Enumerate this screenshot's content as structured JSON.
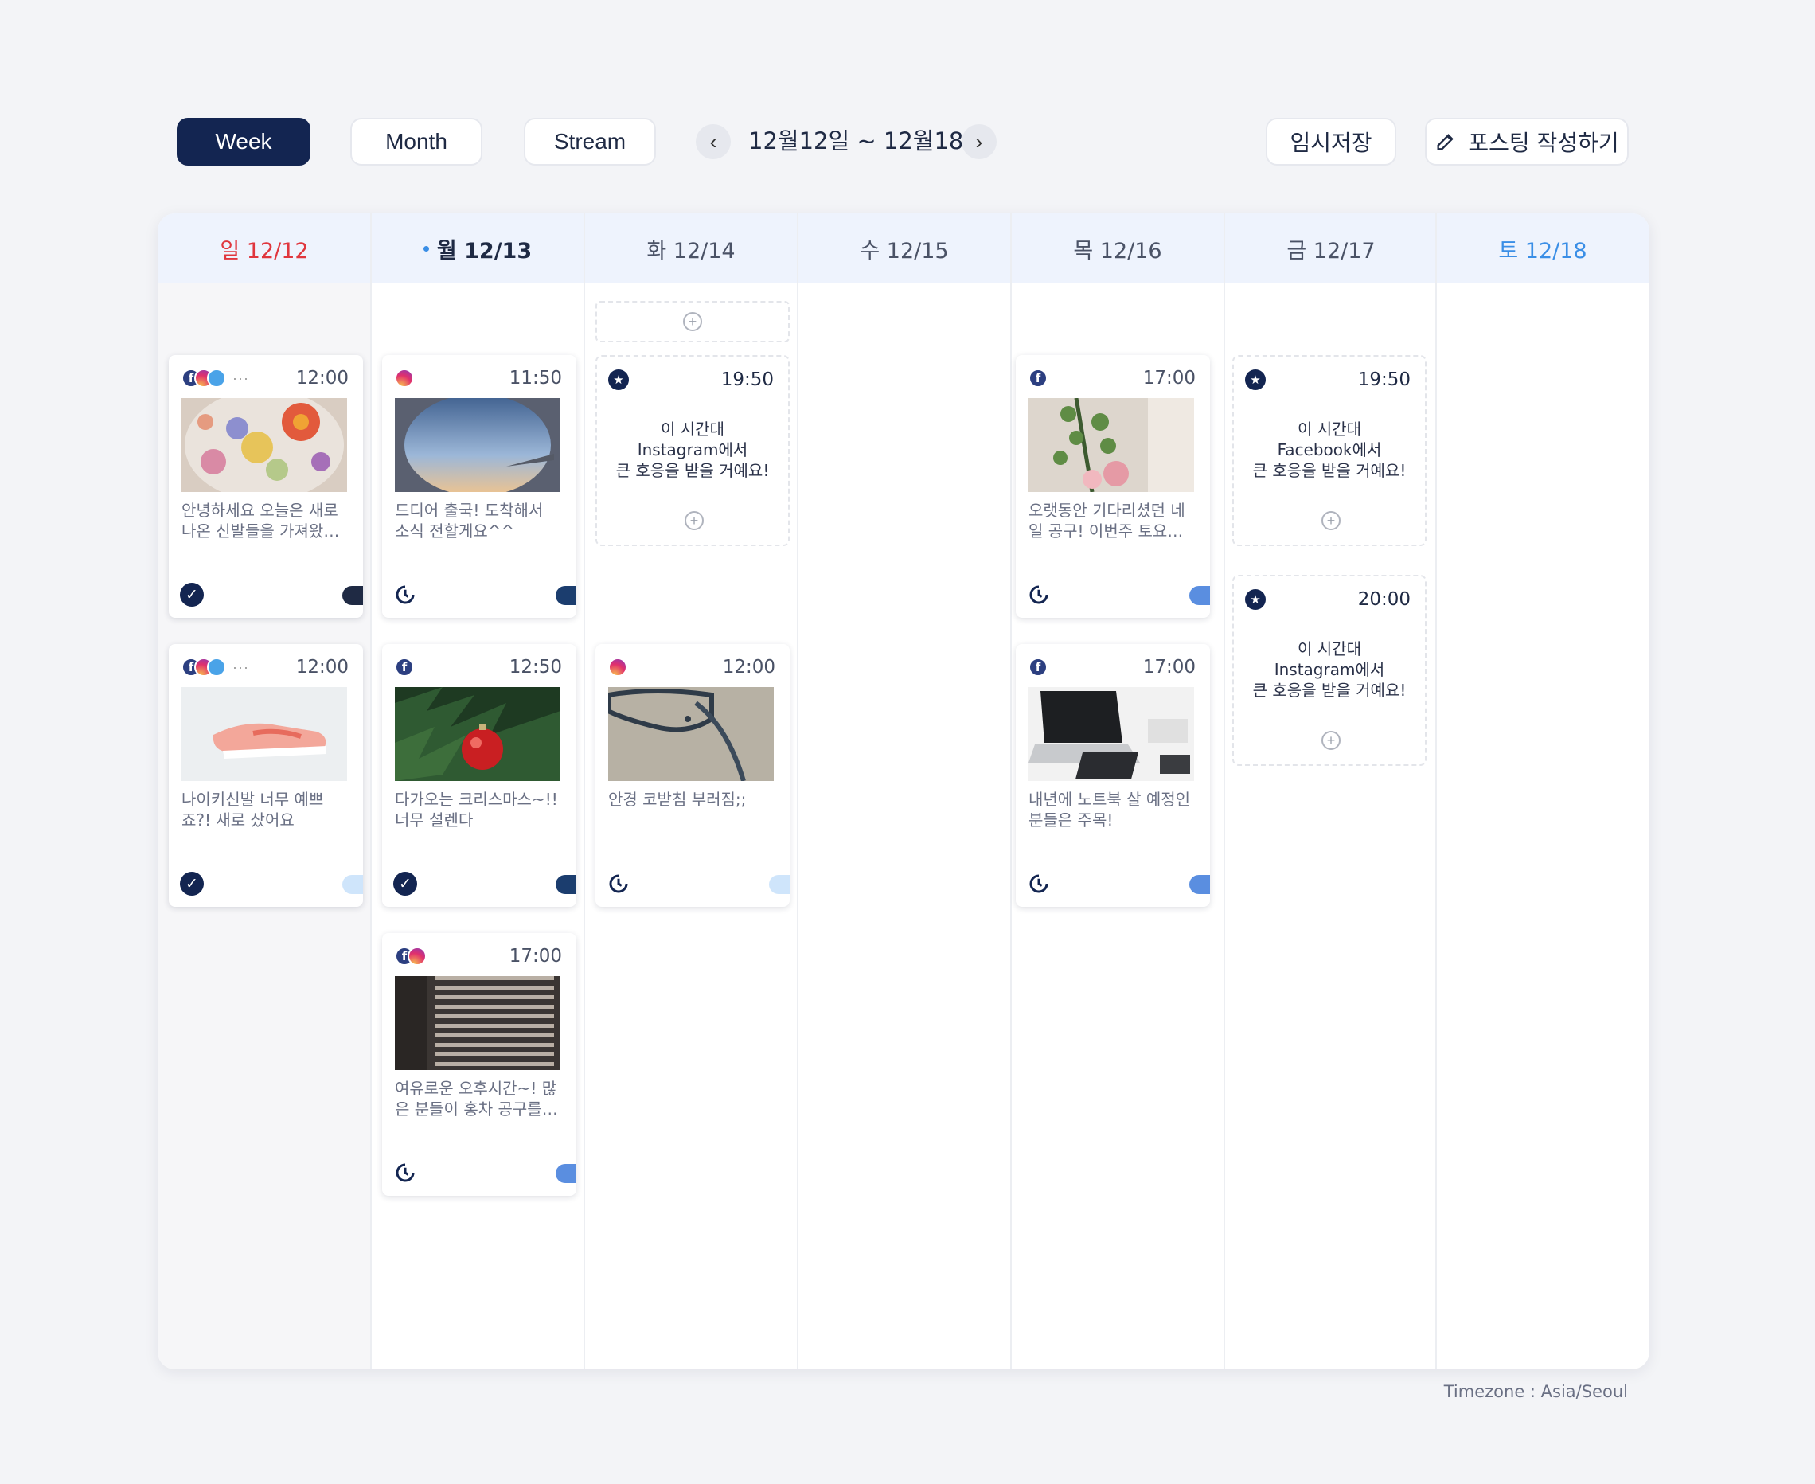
{
  "toolbar": {
    "view_week": "Week",
    "view_month": "Month",
    "view_stream": "Stream",
    "prev_icon": "‹",
    "next_icon": "›",
    "date_range": "12월12일 ~ 12월18일",
    "draft_label": "임시저장",
    "compose_label": "포스팅 작성하기"
  },
  "days": [
    {
      "label": "일 12/12"
    },
    {
      "label": "월 12/13"
    },
    {
      "label": "화 12/14"
    },
    {
      "label": "수 12/15"
    },
    {
      "label": "목 12/16"
    },
    {
      "label": "금 12/17"
    },
    {
      "label": "토 12/18"
    }
  ],
  "posts": {
    "sun_1": {
      "time": "12:00",
      "text": "안녕하세요 오늘은 새로 나온 신발들을 가져왔어요",
      "more": "···"
    },
    "sun_2": {
      "time": "12:00",
      "text": "나이키신발 너무 예쁘죠?! 새로 샀어요",
      "more": "···"
    },
    "mon_1": {
      "time": "11:50",
      "text": "드디어 출국! 도착해서 소식 전할게요^^"
    },
    "mon_2": {
      "time": "12:50",
      "text": "다가오는 크리스마스~!! 너무 설렌다"
    },
    "mon_3": {
      "time": "17:00",
      "text": "여유로운 오후시간~! 많은 분들이 홍차 공구를 기다리셨죠"
    },
    "tue_1": {
      "time": "12:00",
      "text": "안경 코받침 부러짐;;"
    },
    "thu_1": {
      "time": "17:00",
      "text": "오랫동안 기다리셨던 네일 공구! 이번주 토요일 오픈해요"
    },
    "thu_2": {
      "time": "17:00",
      "text": "내년에 노트북 살 예정인 분들은 주목!"
    }
  },
  "suggestions": {
    "tue": {
      "time": "19:50",
      "line1": "이 시간대",
      "line2": "Instagram에서",
      "line3": "큰 호응을 받을 거예요!"
    },
    "fri_1": {
      "time": "19:50",
      "line1": "이 시간대",
      "line2": "Facebook에서",
      "line3": "큰 호응을 받을 거예요!"
    },
    "fri_2": {
      "time": "20:00",
      "line1": "이 시간대",
      "line2": "Instagram에서",
      "line3": "큰 호응을 받을 거예요!"
    }
  },
  "footer": {
    "timezone": "Timezone : Asia/Seoul"
  },
  "colors": {
    "primary": "#132551",
    "sunday": "#e0363d",
    "saturday": "#3a8ee6",
    "header_bg": "#eef3fd"
  }
}
